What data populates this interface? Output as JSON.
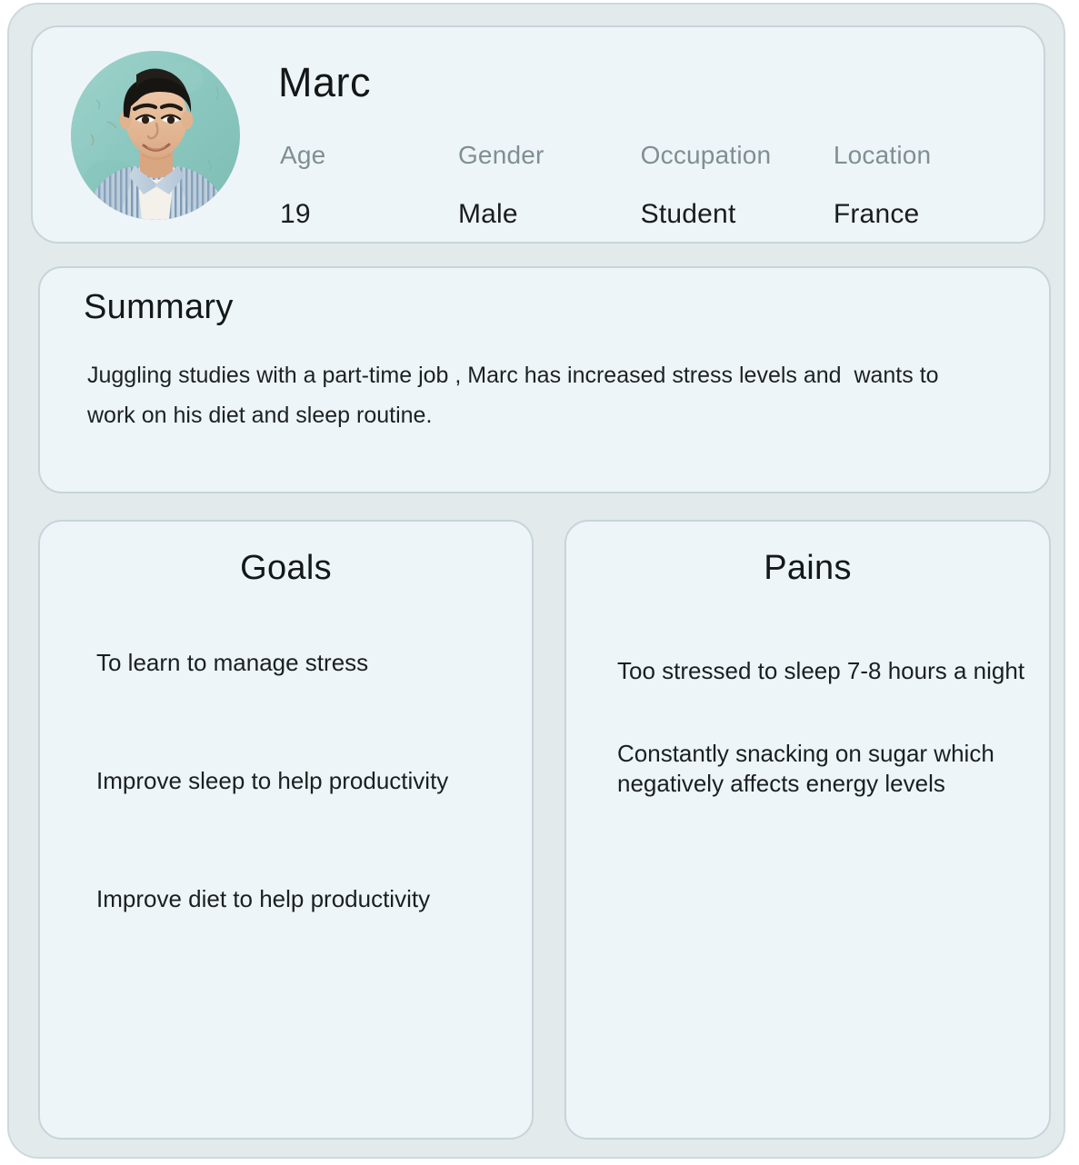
{
  "profile": {
    "name": "Marc",
    "avatar_icon": "user-portrait-photo",
    "attributes": [
      {
        "label": "Age",
        "value": "19"
      },
      {
        "label": "Gender",
        "value": "Male"
      },
      {
        "label": "Occupation",
        "value": "Student"
      },
      {
        "label": "Location",
        "value": "France"
      }
    ]
  },
  "summary": {
    "title": "Summary",
    "body": "Juggling studies with a part-time job , Marc has increased stress levels and  wants to work on his diet and sleep routine."
  },
  "goals": {
    "title": "Goals",
    "items": [
      "To learn to manage stress",
      "Improve sleep to help productivity",
      "Improve diet to help productivity"
    ]
  },
  "pains": {
    "title": "Pains",
    "items": [
      "Too stressed to sleep 7-8 hours a night",
      "Constantly snacking on sugar which negatively affects energy levels"
    ]
  },
  "colors": {
    "shell_background": "#e2eaec",
    "card_background": "#eef5f8",
    "card_border": "#c6d5d9",
    "label_text": "#7f8f94",
    "body_text": "#1b1f21",
    "avatar_backdrop": "#8fc9c1"
  }
}
